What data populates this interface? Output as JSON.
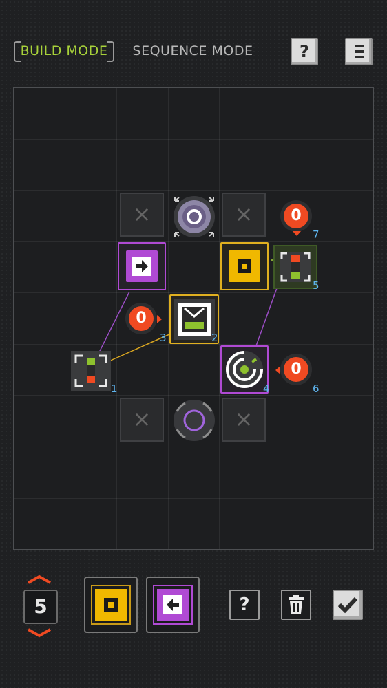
{
  "topbar": {
    "build_mode_label": "BUILD MODE",
    "sequence_mode_label": "SEQUENCE MODE",
    "help_label": "?",
    "menu_icon": "menu-icon"
  },
  "board": {
    "empty_slot_mark": "×",
    "labels": {
      "n1": "1",
      "n2": "2",
      "n3": "3",
      "n4": "4",
      "n5": "5",
      "n6": "6",
      "n7": "7"
    },
    "badges": {
      "b3": "0",
      "b6": "0",
      "b7": "0"
    }
  },
  "bottom": {
    "counter_value": "5",
    "help_label": "?",
    "trash_icon": "trash-icon",
    "confirm_icon": "check-icon"
  },
  "colors": {
    "accent_green": "#a8d23a",
    "purple": "#b04ad4",
    "yellow": "#f0b800",
    "red": "#f04a22",
    "label_blue": "#5fb6f0"
  }
}
